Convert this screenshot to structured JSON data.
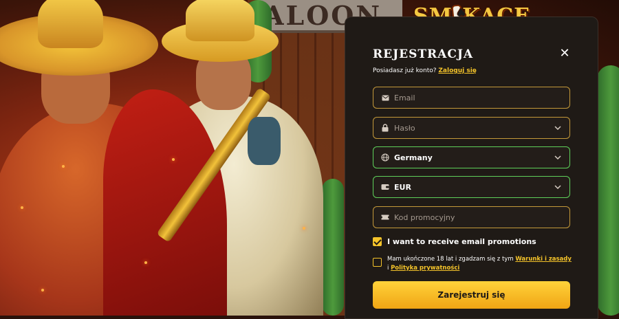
{
  "brand": {
    "logo_left": "SM",
    "logo_right": "KACE",
    "saloon_sign": "ALOON"
  },
  "modal": {
    "title": "REJESTRACJA",
    "close_icon": "close-icon",
    "login_prompt": "Posiadasz już konto?",
    "login_link": "Zaloguj się"
  },
  "form": {
    "email": {
      "placeholder": "Email",
      "icon": "mail-icon"
    },
    "password": {
      "placeholder": "Hasło",
      "icon": "lock-icon",
      "toggle_icon": "chevron-down-icon"
    },
    "country": {
      "value": "Germany",
      "icon": "globe-icon",
      "status_color": "#5fd25a"
    },
    "currency": {
      "value": "EUR",
      "icon": "wallet-icon",
      "status_color": "#5fd25a"
    },
    "promo": {
      "placeholder": "Kod promocyjny",
      "icon": "ticket-icon"
    },
    "email_promotions": {
      "label": "I want to receive email promotions",
      "checked": true
    },
    "terms": {
      "text_before": "Mam ukończone 18 lat i zgadzam się z tym",
      "terms_link": "Warunki i zasady",
      "connector": "i",
      "privacy_link": "Polityka prywatności",
      "checked": false
    },
    "submit_label": "Zarejestruj się"
  },
  "colors": {
    "accent": "#f5c42a",
    "field_border": "#c59a3a",
    "valid_border": "#5fd25a",
    "modal_bg": "#1f1a16"
  }
}
